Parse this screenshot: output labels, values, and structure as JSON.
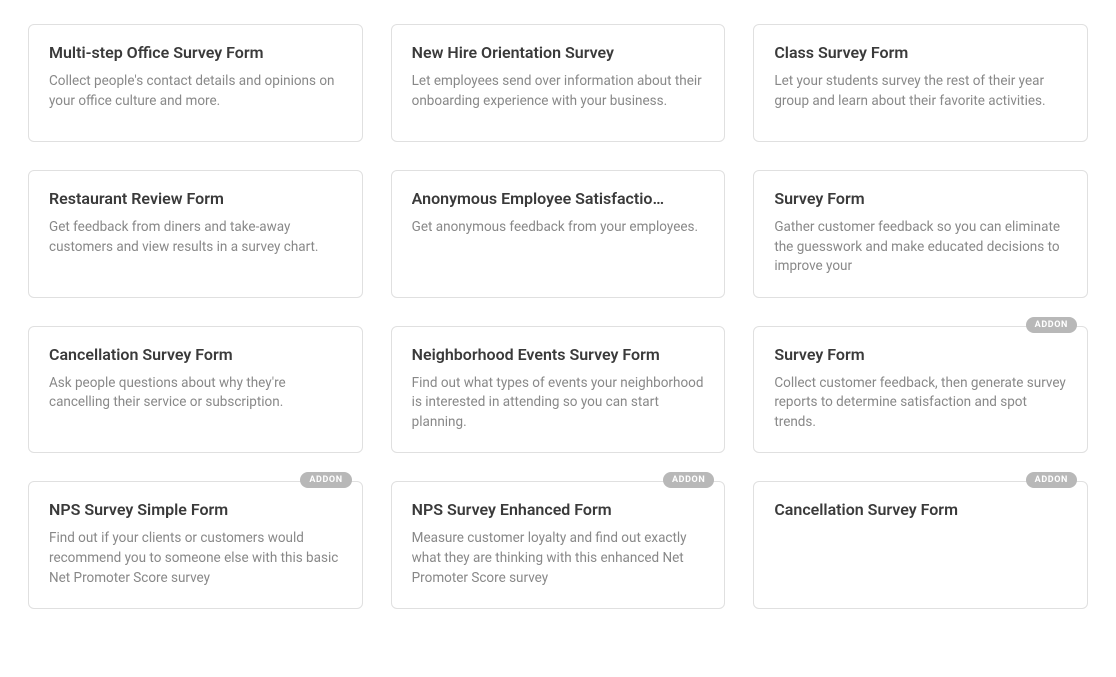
{
  "badge_label": "ADDON",
  "cards": [
    {
      "title": "Multi-step Office Survey Form",
      "description": "Collect people's contact details and opinions on your office culture and more.",
      "addon": false
    },
    {
      "title": "New Hire Orientation Survey",
      "description": "Let employees send over information about their onboarding experience with your business.",
      "addon": false
    },
    {
      "title": "Class Survey Form",
      "description": "Let your students survey the rest of their year group and learn about their favorite activities.",
      "addon": false
    },
    {
      "title": "Restaurant Review Form",
      "description": "Get feedback from diners and take-away customers and view results in a survey chart.",
      "addon": false
    },
    {
      "title": "Anonymous Employee Satisfactio…",
      "description": "Get anonymous feedback from your employees.",
      "addon": false
    },
    {
      "title": "Survey Form",
      "description": "Gather customer feedback so you can eliminate the guesswork and make educated decisions to improve your",
      "addon": false
    },
    {
      "title": "Cancellation Survey Form",
      "description": "Ask people questions about why they're cancelling their service or subscription.",
      "addon": false
    },
    {
      "title": "Neighborhood Events Survey Form",
      "description": "Find out what types of events your neighborhood is interested in attending so you can start planning.",
      "addon": false
    },
    {
      "title": "Survey Form",
      "description": "Collect customer feedback, then generate survey reports to determine satisfaction and spot trends.",
      "addon": true
    },
    {
      "title": "NPS Survey Simple Form",
      "description": "Find out if your clients or customers would recommend you to someone else with this basic Net Promoter Score survey",
      "addon": true
    },
    {
      "title": "NPS Survey Enhanced Form",
      "description": "Measure customer loyalty and find out exactly what they are thinking with this enhanced Net Promoter Score survey",
      "addon": true
    },
    {
      "title": "Cancellation Survey Form",
      "description": "",
      "addon": true
    }
  ]
}
